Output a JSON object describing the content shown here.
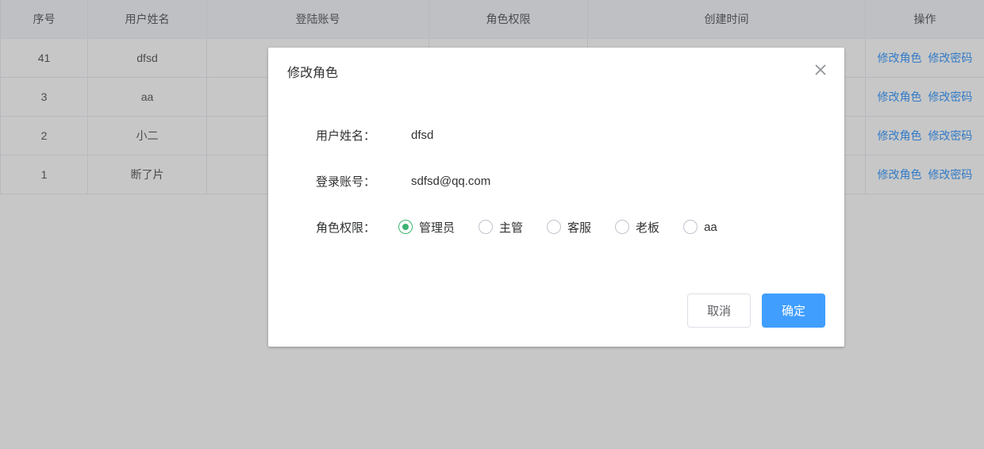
{
  "table": {
    "headers": {
      "seq": "序号",
      "name": "用户姓名",
      "account": "登陆账号",
      "role": "角色权限",
      "time": "创建时间",
      "op": "操作"
    },
    "rows": [
      {
        "seq": "41",
        "name": "dfsd"
      },
      {
        "seq": "3",
        "name": "aa"
      },
      {
        "seq": "2",
        "name": "小二"
      },
      {
        "seq": "1",
        "name": "断了片"
      }
    ],
    "action_role": "修改角色",
    "action_pwd": "修改密码"
  },
  "dialog": {
    "title": "修改角色",
    "labels": {
      "name": "用户姓名：",
      "account": "登录账号：",
      "role": "角色权限："
    },
    "values": {
      "name": "dfsd",
      "account": "sdfsd@qq.com"
    },
    "roles": [
      {
        "label": "管理员",
        "selected": true
      },
      {
        "label": "主管",
        "selected": false
      },
      {
        "label": "客服",
        "selected": false
      },
      {
        "label": "老板",
        "selected": false
      },
      {
        "label": "aa",
        "selected": false
      }
    ],
    "buttons": {
      "cancel": "取消",
      "confirm": "确定"
    }
  }
}
